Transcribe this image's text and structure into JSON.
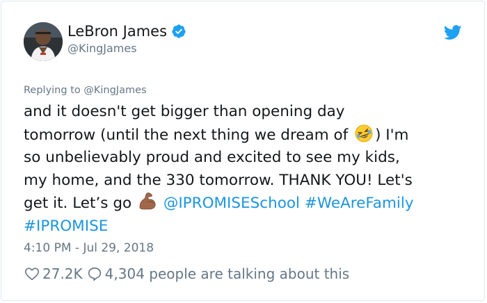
{
  "author": {
    "name": "LeBron James",
    "handle": "@KingJames"
  },
  "replying_to": "Replying to @KingJames",
  "tweet": {
    "line1": "and it doesn't get bigger than opening day",
    "line2_pre": "tomorrow (until the next thing we dream of ",
    "line2_post": ") I'm",
    "line3": "so unbelievably proud and excited to see my kids,",
    "line4": "my home, and the 330 tomorrow. THANK YOU! Let's",
    "line5_pre": "get it. Let’s go ",
    "mention": "@IPROMISESchool",
    "hashtag1": "#WeAreFamily",
    "hashtag2": "#IPROMISE"
  },
  "timestamp": "4:10 PM - Jul 29, 2018",
  "stats": {
    "likes": "27.2K",
    "talking": "4,304 people are talking about this"
  },
  "icons": [
    "verified-badge-icon",
    "twitter-bird-icon",
    "laughing-emoji-icon",
    "flexed-biceps-emoji-icon",
    "heart-icon",
    "comment-icon"
  ],
  "colors": {
    "link": "#1b95e0",
    "muted": "#657786",
    "text": "#14171a",
    "border": "#e1e8ed"
  }
}
